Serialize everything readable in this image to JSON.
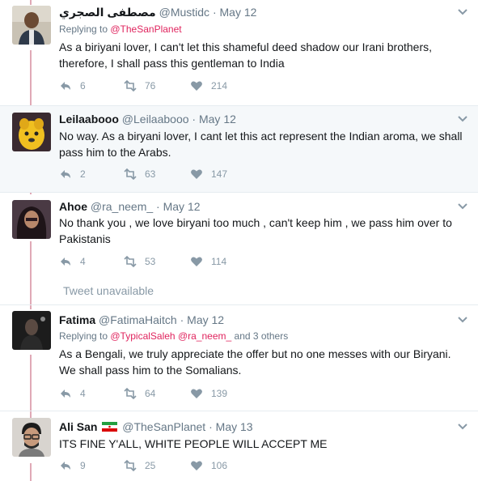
{
  "tweets": [
    {
      "name": "مصطفى الصجري",
      "handle": "@Mustidc",
      "date": "May 12",
      "replying_prefix": "Replying to ",
      "replying_to": [
        "@TheSanPlanet"
      ],
      "replying_suffix": "",
      "text": "As a biriyani lover, I can't let this shameful deed shadow our Irani brothers, therefore, I shall pass this gentleman to India",
      "replies": "6",
      "retweets": "76",
      "likes": "214"
    },
    {
      "name": "Leilaabooo",
      "handle": "@Leilaabooo",
      "date": "May 12",
      "text": "No way. As a biryani lover, I cant let this act represent the Indian aroma, we shall pass him to the Arabs.",
      "replies": "2",
      "retweets": "63",
      "likes": "147"
    },
    {
      "name": "Ahoe",
      "handle": "@ra_neem_",
      "date": "May 12",
      "text": "No thank you , we love biryani too much , can't keep him , we pass him over to Pakistanis",
      "replies": "4",
      "retweets": "53",
      "likes": "114"
    },
    {
      "name": "Fatima",
      "handle": "@FatimaHaitch",
      "date": "May 12",
      "replying_prefix": "Replying to ",
      "replying_to": [
        "@TypicalSaleh",
        "@ra_neem_"
      ],
      "replying_suffix": "and 3 others",
      "text": "As a Bengali, we truly appreciate the offer but no one messes with our Biryani. We shall pass him to the Somalians.",
      "replies": "4",
      "retweets": "64",
      "likes": "139"
    },
    {
      "name": "Ali San",
      "handle": "@TheSanPlanet",
      "date": "May 13",
      "text": "ITS FINE Y'ALL, WHITE PEOPLE WILL ACCEPT ME",
      "replies": "9",
      "retweets": "25",
      "likes": "106"
    }
  ],
  "unavailable_text": "Tweet unavailable",
  "separator": "·",
  "icons": {
    "reply": "reply-icon",
    "retweet": "retweet-icon",
    "like": "heart-icon",
    "menu": "chevron-down-icon",
    "flag": "iran-flag-icon"
  },
  "colors": {
    "thread_line": "#e0a9b6",
    "link": "#e0245e",
    "muted": "#657786",
    "icon": "#8899a6",
    "highlight_bg": "#f5f8fa"
  }
}
